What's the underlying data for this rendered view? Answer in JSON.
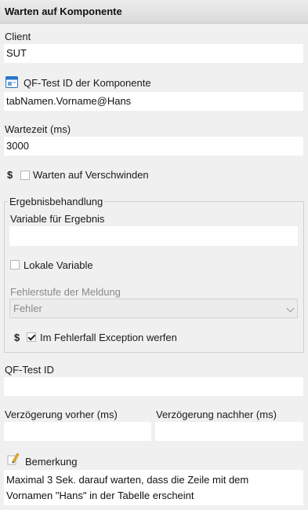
{
  "header": {
    "title": "Warten auf Komponente"
  },
  "client": {
    "label": "Client",
    "value": "SUT"
  },
  "component_id": {
    "label": "QF-Test ID der Komponente",
    "value": "tabNamen.Vorname@Hans",
    "icon": "component-window-icon"
  },
  "timeout": {
    "label": "Wartezeit (ms)",
    "value": "3000"
  },
  "wait_disappear": {
    "label": "Warten auf Verschwinden",
    "checked": false,
    "dollar": "$"
  },
  "result_group": {
    "title": "Ergebnisbehandlung",
    "variable_label": "Variable für Ergebnis",
    "variable_value": "",
    "local_variable_label": "Lokale Variable",
    "local_variable_checked": false,
    "error_level_label": "Fehlerstufe der Meldung",
    "error_level_value": "Fehler",
    "throw_exception_label": "Im Fehlerfall Exception werfen",
    "throw_exception_checked": true,
    "dollar": "$"
  },
  "qftest_id": {
    "label": "QF-Test ID",
    "value": ""
  },
  "delay_before": {
    "label": "Verzögerung vorher (ms)",
    "value": ""
  },
  "delay_after": {
    "label": "Verzögerung nachher (ms)",
    "value": ""
  },
  "comment": {
    "label": "Bemerkung",
    "icon": "pencil-note-icon",
    "lines": [
      "Maximal 3 Sek. darauf warten, dass die Zeile mit dem",
      "Vornamen \"Hans\" in der Tabelle erscheint"
    ]
  }
}
